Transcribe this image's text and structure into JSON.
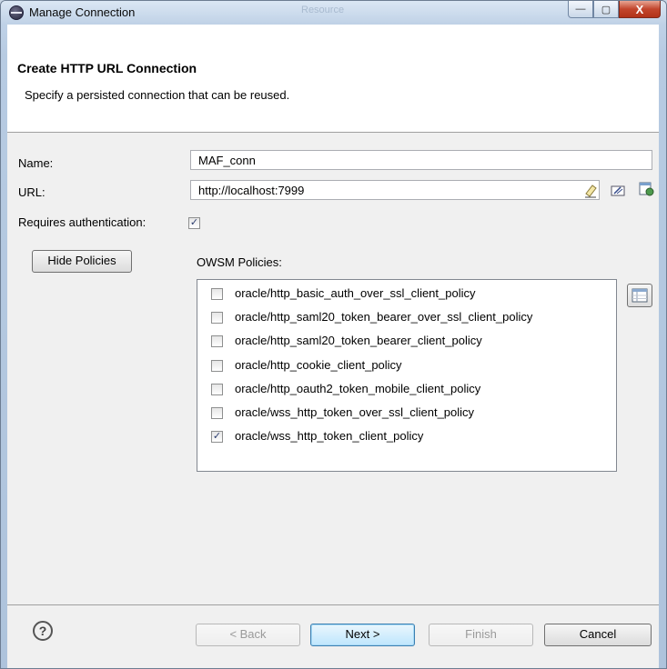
{
  "window": {
    "title": "Manage Connection",
    "background_tab": "Resource",
    "minimize_glyph": "—",
    "maximize_glyph": "▢",
    "close_glyph": "X"
  },
  "header": {
    "title": "Create HTTP URL Connection",
    "description": "Specify a persisted connection that can be reused."
  },
  "form": {
    "name_label": "Name:",
    "name_value": "MAF_conn",
    "url_label": "URL:",
    "url_value": "http://localhost:7999",
    "requires_auth_label": "Requires authentication:",
    "requires_auth_checked": true,
    "hide_policies_label": "Hide Policies",
    "owsm_label": "OWSM Policies:"
  },
  "policies": [
    {
      "label": "oracle/http_basic_auth_over_ssl_client_policy",
      "checked": false
    },
    {
      "label": "oracle/http_saml20_token_bearer_over_ssl_client_policy",
      "checked": false
    },
    {
      "label": "oracle/http_saml20_token_bearer_client_policy",
      "checked": false
    },
    {
      "label": "oracle/http_cookie_client_policy",
      "checked": false
    },
    {
      "label": "oracle/http_oauth2_token_mobile_client_policy",
      "checked": false
    },
    {
      "label": "oracle/wss_http_token_over_ssl_client_policy",
      "checked": false
    },
    {
      "label": "oracle/wss_http_token_client_policy",
      "checked": true
    }
  ],
  "footer": {
    "help_glyph": "?",
    "back_label": "< Back",
    "next_label": "Next >",
    "finish_label": "Finish",
    "cancel_label": "Cancel"
  },
  "icons": {
    "window": "eclipse-icon",
    "url_clear": "eraser-icon",
    "url_edit": "edit-url-icon",
    "url_browse": "browse-icon",
    "policies_view": "table-view-icon",
    "help": "help-icon"
  }
}
